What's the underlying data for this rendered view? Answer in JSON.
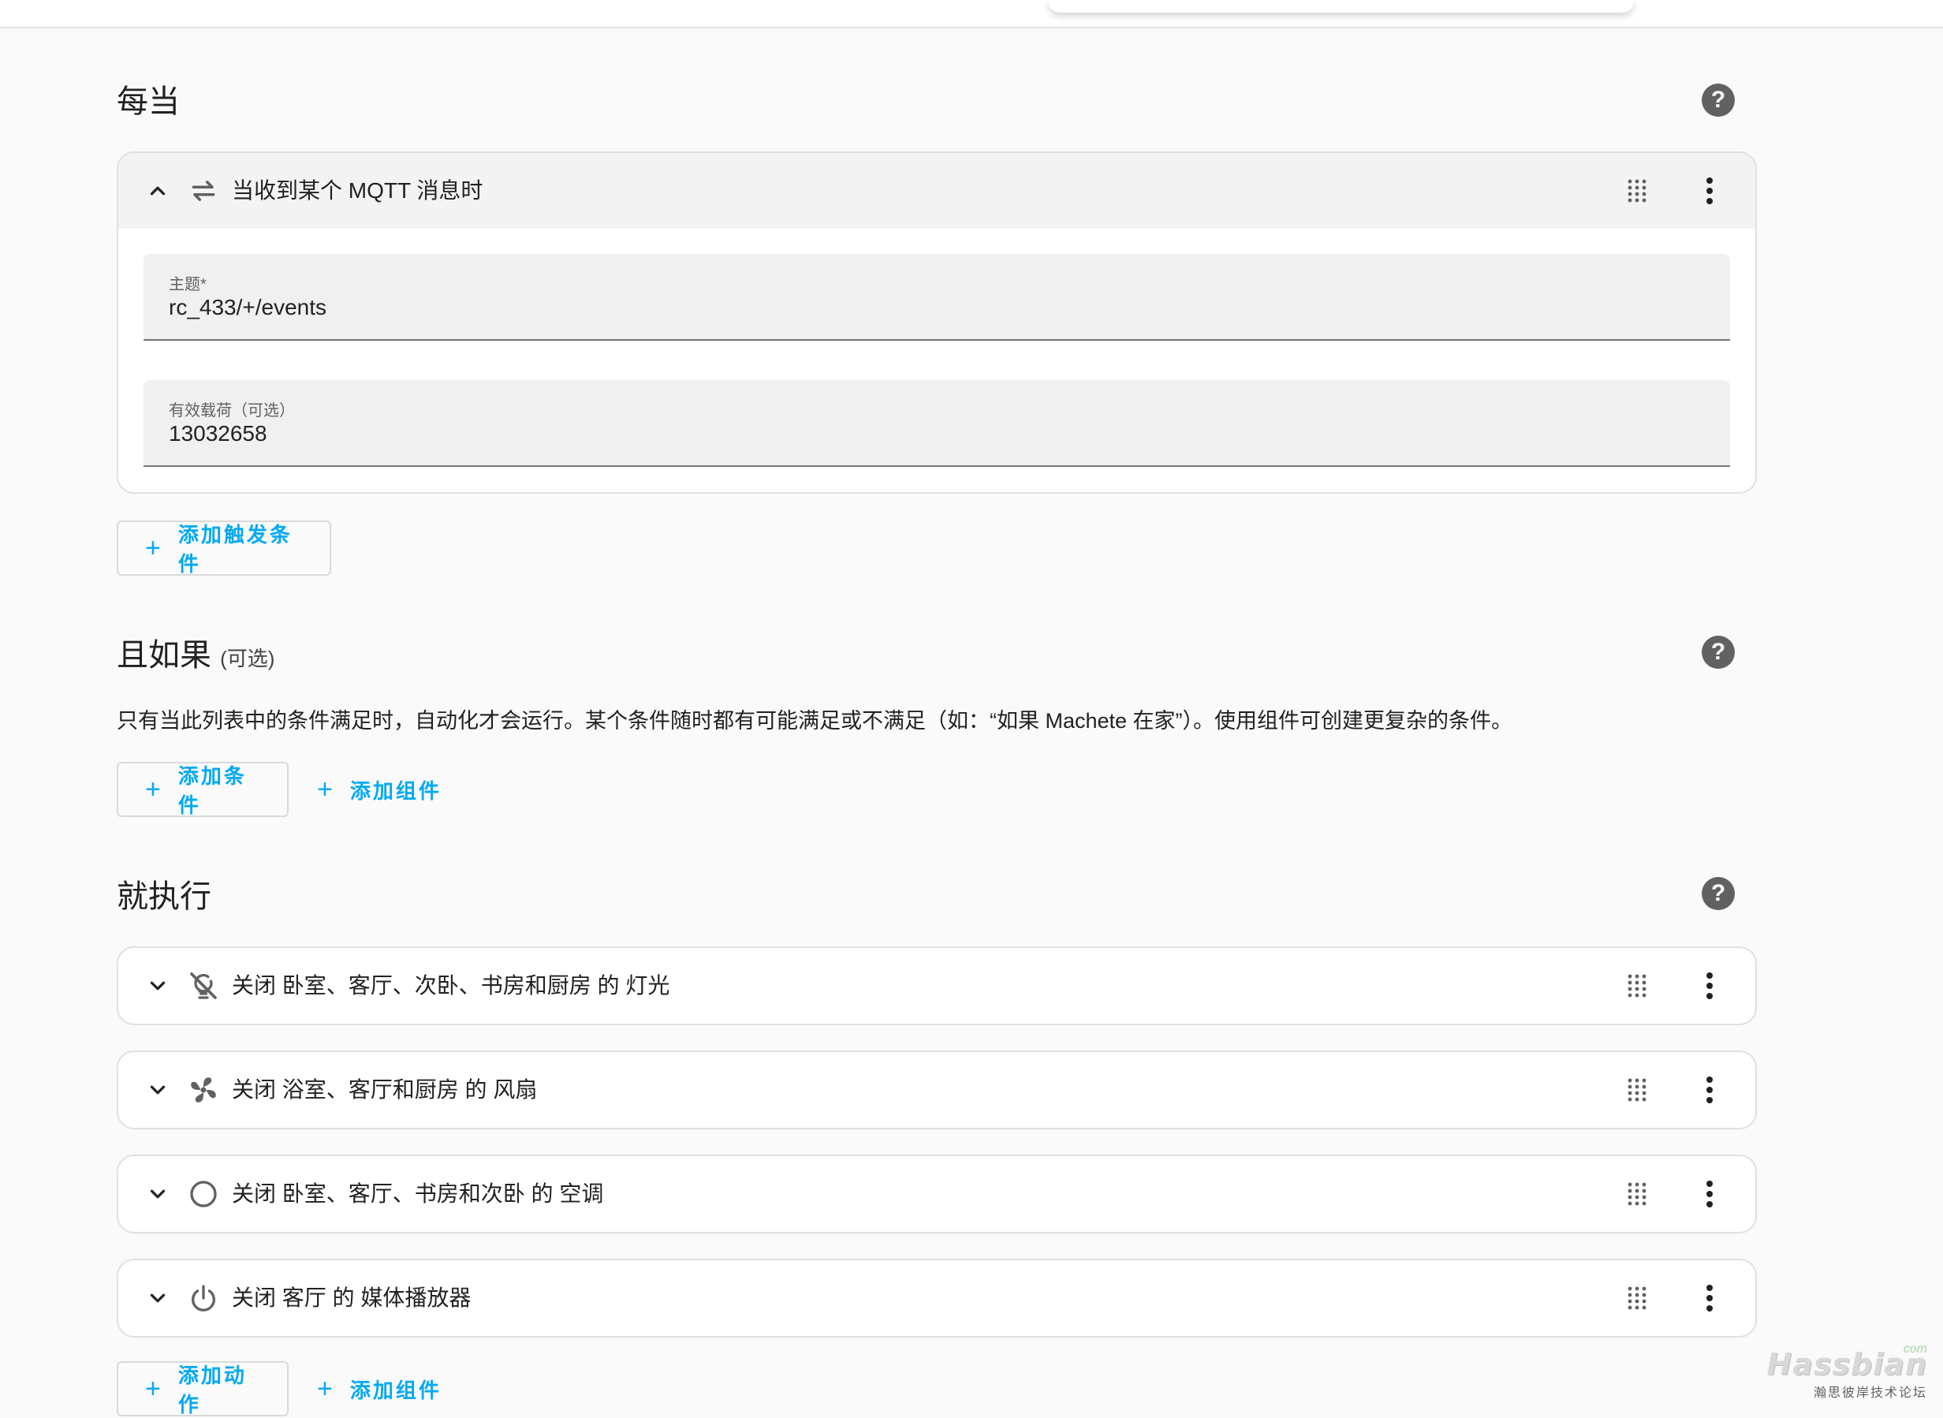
{
  "triggers": {
    "title": "每当",
    "items": [
      {
        "title": "当收到某个 MQTT 消息时",
        "icon": "swap-horizontal-icon",
        "fields": [
          {
            "label": "主题*",
            "value": "rc_433/+/events"
          },
          {
            "label": "有效载荷（可选）",
            "value": "13032658"
          }
        ]
      }
    ],
    "add_button": "添加触发条件"
  },
  "conditions": {
    "title": "且如果",
    "optional": "(可选)",
    "description": "只有当此列表中的条件满足时，自动化才会运行。某个条件随时都有可能满足或不满足（如：“如果 Machete 在家”）。使用组件可创建更复杂的条件。",
    "add_button": "添加条件",
    "add_block_button": "添加组件"
  },
  "actions": {
    "title": "就执行",
    "items": [
      {
        "title": "关闭 卧室、客厅、次卧、书房和厨房 的 灯光",
        "icon": "lightbulb-off-icon"
      },
      {
        "title": "关闭 浴室、客厅和厨房 的 风扇",
        "icon": "fan-icon"
      },
      {
        "title": "关闭 卧室、客厅、书房和次卧 的 空调",
        "icon": "circle-outline-icon"
      },
      {
        "title": "关闭 客厅 的 媒体播放器",
        "icon": "power-icon"
      }
    ],
    "add_button": "添加动作",
    "add_block_button": "添加组件"
  },
  "help_label": "?",
  "plus_symbol": "+",
  "colors": {
    "accent": "#03a9f4",
    "icon": "#616161",
    "background": "#fafafa"
  },
  "watermark": {
    "main": "Hassbian",
    "sub": "瀚思彼岸技术论坛",
    "com": "com"
  }
}
